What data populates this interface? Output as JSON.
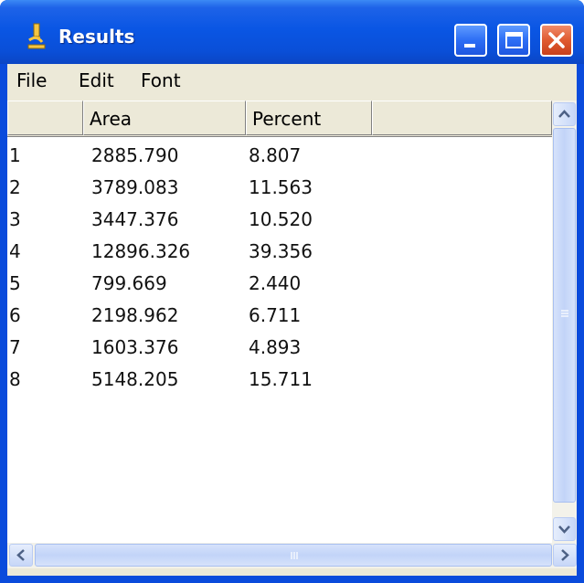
{
  "window": {
    "title": "Results",
    "app_icon": "microscope-icon",
    "controls": [
      "minimize-icon",
      "maximize-icon",
      "close-icon"
    ]
  },
  "menu": {
    "items": [
      {
        "label": "File"
      },
      {
        "label": "Edit"
      },
      {
        "label": "Font"
      }
    ]
  },
  "table": {
    "columns": [
      "",
      "Area",
      "Percent",
      ""
    ],
    "rows": [
      {
        "index": "1",
        "area": "2885.790",
        "percent": "8.807"
      },
      {
        "index": "2",
        "area": "3789.083",
        "percent": "11.563"
      },
      {
        "index": "3",
        "area": "3447.376",
        "percent": "10.520"
      },
      {
        "index": "4",
        "area": "12896.326",
        "percent": "39.356"
      },
      {
        "index": "5",
        "area": "799.669",
        "percent": "2.440"
      },
      {
        "index": "6",
        "area": "2198.962",
        "percent": "6.711"
      },
      {
        "index": "7",
        "area": "1603.376",
        "percent": "4.893"
      },
      {
        "index": "8",
        "area": "5148.205",
        "percent": "15.711"
      }
    ]
  },
  "scrollbars": {
    "vertical_icons": [
      "scroll-up-icon",
      "scroll-down-icon"
    ],
    "horizontal_icons": [
      "scroll-left-icon",
      "scroll-right-icon"
    ]
  },
  "colors": {
    "titlebar": "#0a56e4",
    "close_button": "#e05a30",
    "chrome": "#ece9d8"
  }
}
